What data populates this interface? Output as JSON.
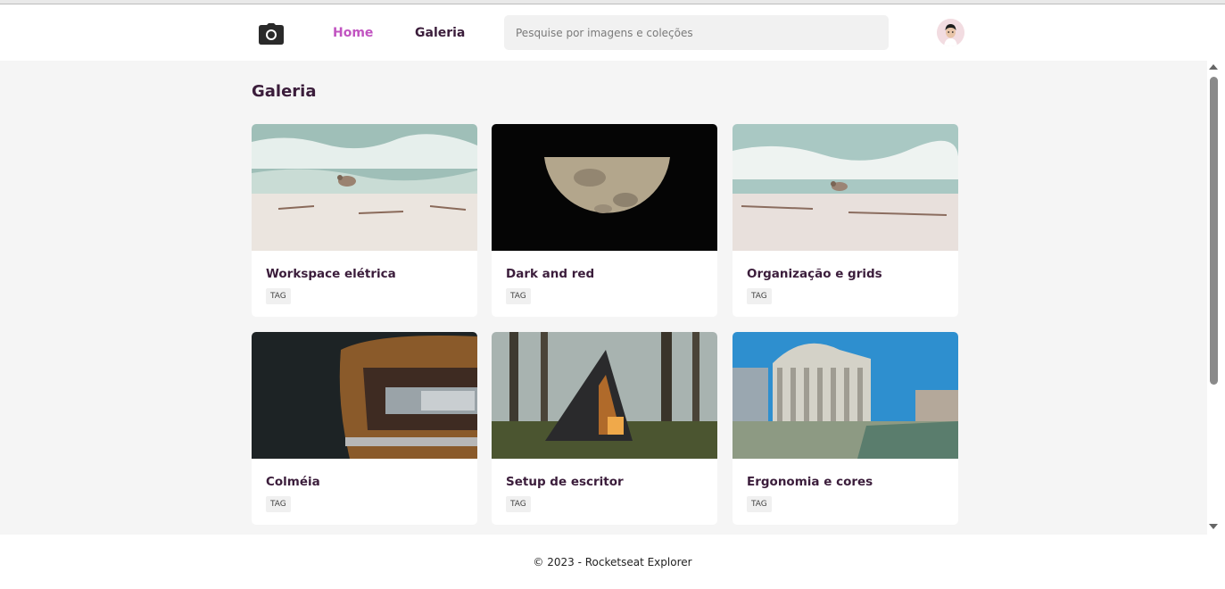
{
  "header": {
    "logo_icon": "camera-icon",
    "nav": {
      "home": "Home",
      "gallery": "Galeria"
    },
    "search": {
      "placeholder": "Pesquise por imagens e coleções",
      "value": ""
    },
    "avatar_icon": "user-avatar"
  },
  "main": {
    "title": "Galeria",
    "cards": [
      {
        "title": "Workspace elétrica",
        "tag": "TAG",
        "image": "beach-bird"
      },
      {
        "title": "Dark and red",
        "tag": "TAG",
        "image": "half-moon"
      },
      {
        "title": "Organização e grids",
        "tag": "TAG",
        "image": "beach-bird"
      },
      {
        "title": "Colméia",
        "tag": "TAG",
        "image": "vintage-car"
      },
      {
        "title": "Setup de escritor",
        "tag": "TAG",
        "image": "forest-cabin"
      },
      {
        "title": "Ergonomia e cores",
        "tag": "TAG",
        "image": "classical-building"
      }
    ]
  },
  "footer": {
    "text": "© 2023 - Rocketseat Explorer"
  },
  "colors": {
    "accent": "#c154c1",
    "text": "#3b1d3b",
    "background": "#f5f5f5"
  }
}
